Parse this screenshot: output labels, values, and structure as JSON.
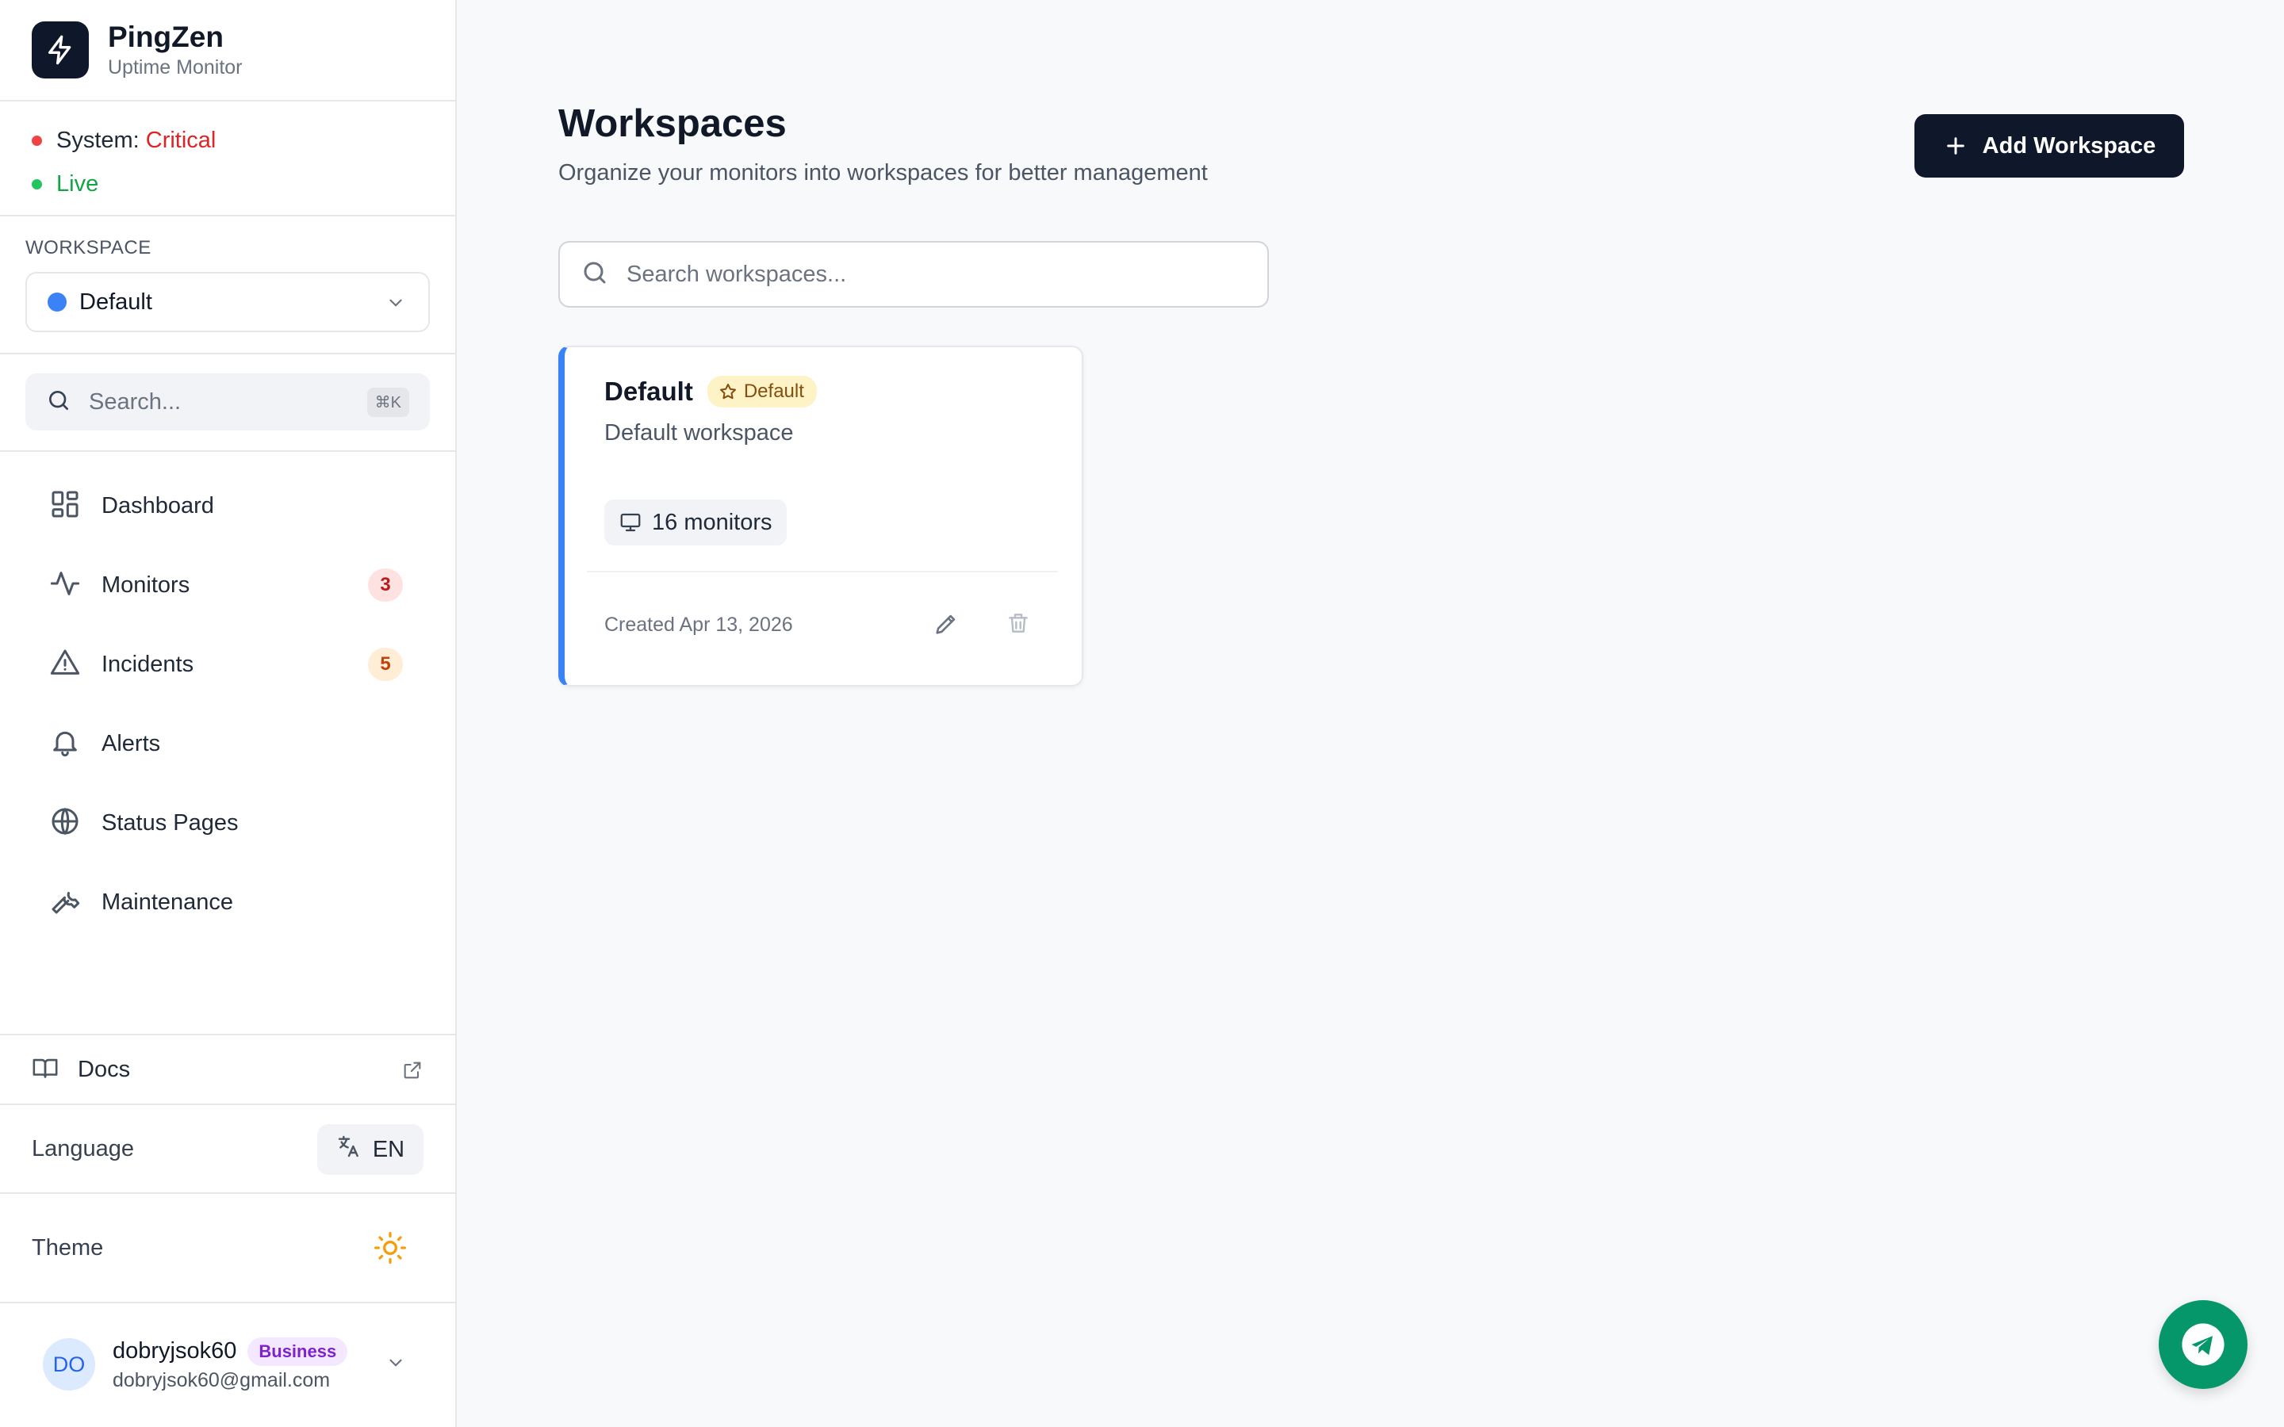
{
  "brand": {
    "name": "PingZen",
    "subtitle": "Uptime Monitor"
  },
  "status": {
    "system_label": "System:",
    "system_value": "Critical",
    "live": "Live"
  },
  "workspace_selector": {
    "label": "WORKSPACE",
    "value": "Default"
  },
  "sidebar_search": {
    "placeholder": "Search...",
    "shortcut": "⌘K"
  },
  "nav": [
    {
      "label": "Dashboard"
    },
    {
      "label": "Monitors",
      "badge": "3"
    },
    {
      "label": "Incidents",
      "badge": "5"
    },
    {
      "label": "Alerts"
    },
    {
      "label": "Status Pages"
    },
    {
      "label": "Maintenance"
    }
  ],
  "docs": {
    "label": "Docs"
  },
  "language": {
    "label": "Language",
    "value": "EN"
  },
  "theme": {
    "label": "Theme"
  },
  "user": {
    "initials": "DO",
    "name": "dobryjsok60",
    "plan": "Business",
    "email": "dobryjsok60@gmail.com"
  },
  "page": {
    "title": "Workspaces",
    "subtitle": "Organize your monitors into workspaces for better management",
    "add_button": "Add Workspace",
    "search_placeholder": "Search workspaces..."
  },
  "workspaces": [
    {
      "name": "Default",
      "badge": "Default",
      "description": "Default workspace",
      "monitors": "16 monitors",
      "created": "Created Apr 13, 2026"
    }
  ],
  "colors": {
    "critical": "#dc2626",
    "live": "#16a34a",
    "accent": "#3b82f6",
    "primary": "#0f172a",
    "fab": "#059669"
  },
  "icons": {
    "brand": "bolt-icon",
    "dashboard": "grid-icon",
    "monitors": "activity-icon",
    "incidents": "warning-icon",
    "alerts": "bell-icon",
    "status_pages": "globe-icon",
    "maintenance": "wrench-icon",
    "docs": "book-icon",
    "language": "translate-icon",
    "theme": "sun-icon",
    "fab": "telegram-icon"
  }
}
